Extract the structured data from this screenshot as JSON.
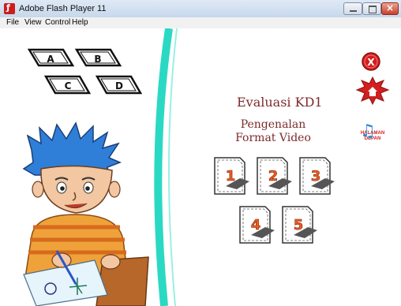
{
  "window": {
    "title": "Adobe Flash Player 11"
  },
  "menu": {
    "file": "File",
    "view": "View",
    "control": "Control",
    "help": "Help"
  },
  "options": [
    "A",
    "B",
    "C",
    "D"
  ],
  "content": {
    "title": "Evaluasi KD1",
    "subtitle_line1": "Pengenalan",
    "subtitle_line2": "Format Video"
  },
  "controls": {
    "close_label": "X",
    "home_line1": "HALAMAN",
    "home_line2": "DEPAN",
    "music_icon": "♫"
  },
  "questions": [
    "1",
    "2",
    "3",
    "4",
    "5"
  ],
  "colors": {
    "accent": "#2ad9c3",
    "number": "#ee5a20",
    "title": "#7d2a2a",
    "close": "#d21f1f"
  }
}
